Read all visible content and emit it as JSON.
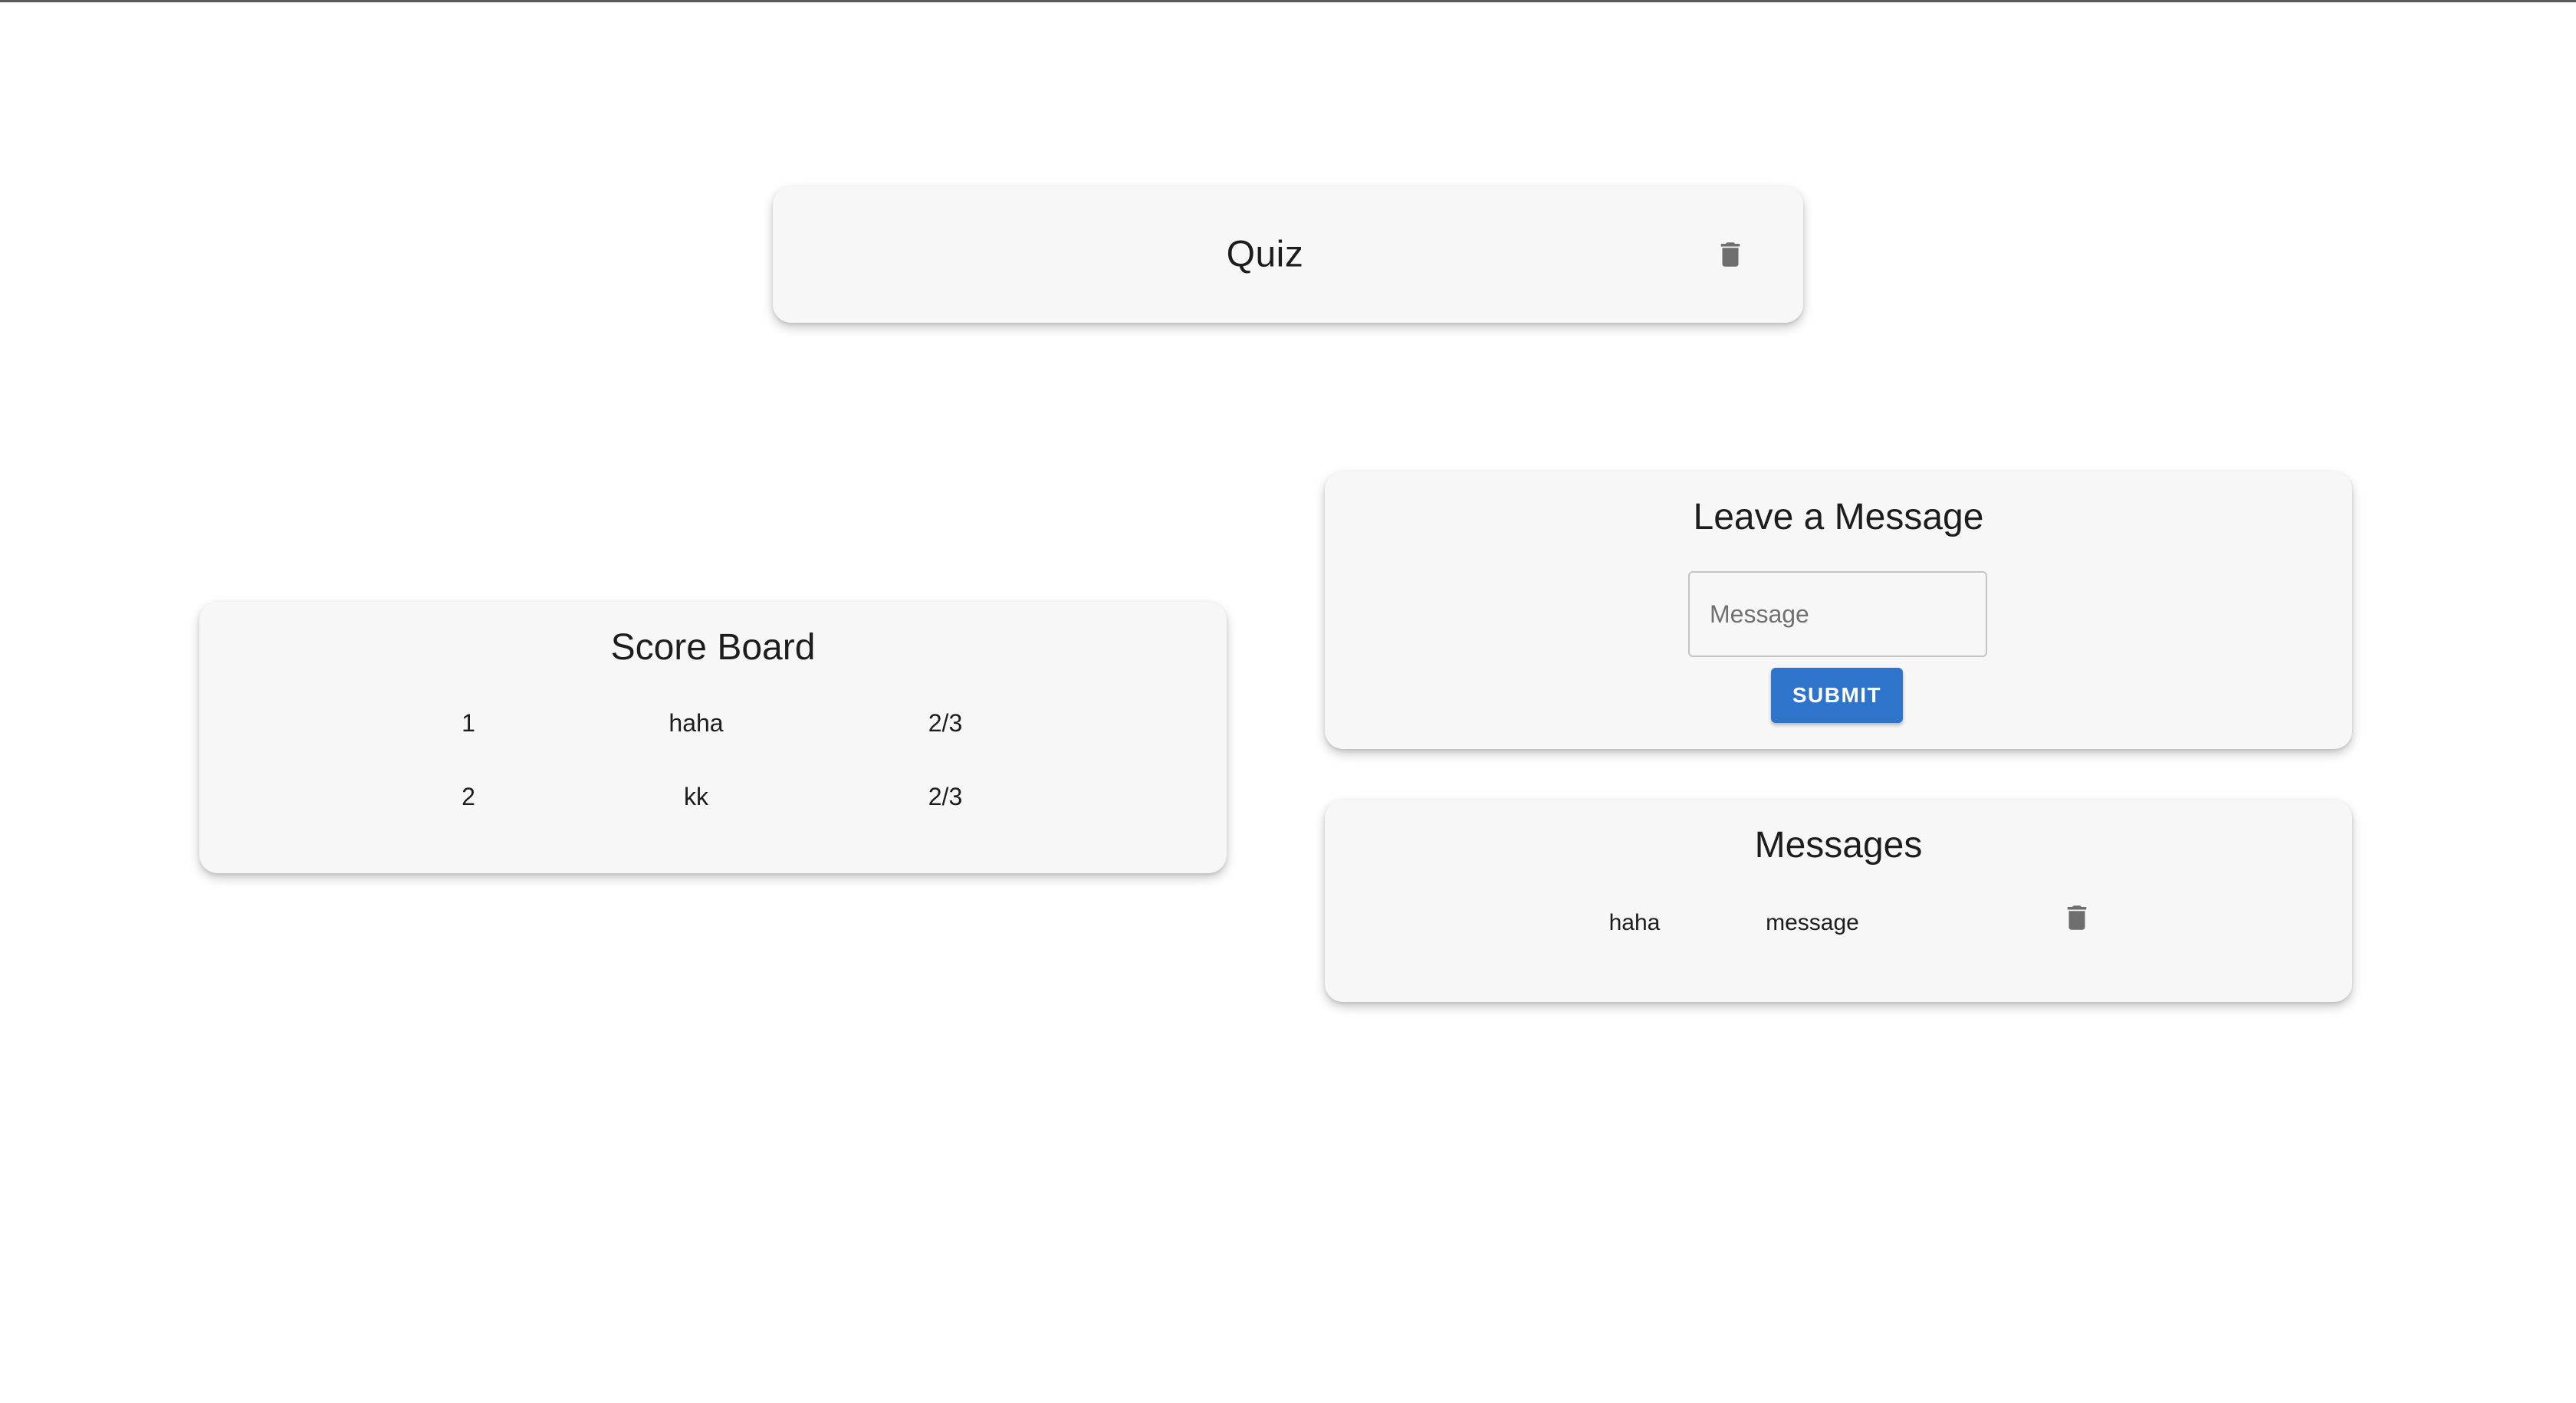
{
  "quiz": {
    "title": "Quiz",
    "delete_icon": "trash-icon"
  },
  "score_board": {
    "title": "Score Board",
    "rows": [
      {
        "rank": "1",
        "name": "haha",
        "score": "2/3"
      },
      {
        "rank": "2",
        "name": "kk",
        "score": "2/3"
      }
    ]
  },
  "leave_message": {
    "title": "Leave a Message",
    "input_placeholder": "Message",
    "input_value": "",
    "submit_label": "SUBMIT"
  },
  "messages": {
    "title": "Messages",
    "items": [
      {
        "author": "haha",
        "text": "message",
        "delete_icon": "trash-icon"
      }
    ]
  },
  "colors": {
    "card_background": "#f7f7f7",
    "submit_button": "#2f74cb",
    "icon": "#6e6e6e"
  }
}
